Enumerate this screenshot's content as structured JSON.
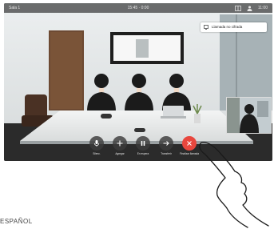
{
  "top_bar": {
    "left_text": "Sala 1",
    "center_text": "15:45 · 0:00",
    "right_text": "11:00",
    "icons": [
      "layout-icon",
      "participants-icon"
    ]
  },
  "notification": {
    "icon": "screen-share-icon",
    "text": "Llamada no cifrada"
  },
  "controls": [
    {
      "name": "mute",
      "icon": "microphone-icon",
      "label": "Silenc."
    },
    {
      "name": "add",
      "icon": "plus-icon",
      "label": "Agregar"
    },
    {
      "name": "hold",
      "icon": "pause-icon",
      "label": "En espera"
    },
    {
      "name": "transfer",
      "icon": "arrow-right-icon",
      "label": "Transferir"
    },
    {
      "name": "end-call",
      "icon": "hangup-icon",
      "label": "Finalizar llamada"
    }
  ],
  "colors": {
    "end_call": "#e8473e",
    "control_bg": "#3c3c3c",
    "notice_bg": "#ffffff"
  },
  "footer": {
    "language_label": "ESPAÑOL"
  }
}
